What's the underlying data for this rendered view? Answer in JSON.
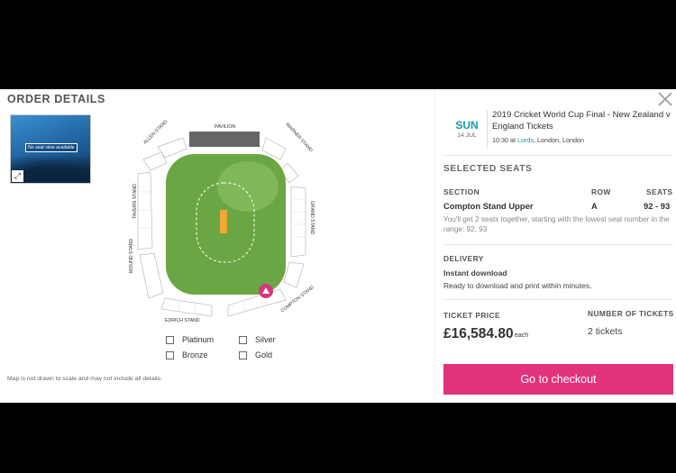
{
  "modal": {
    "title": "ORDER DETAILS",
    "close_icon": "close-icon"
  },
  "seat_view": {
    "no_view_text": "No seat view available",
    "expand_icon": "expand-icon"
  },
  "map": {
    "stands": {
      "pavilion": "PAVILION",
      "allen": "ALLEN STAND",
      "warner": "WARNER STAND",
      "tavern": "TAVERN STAND",
      "grand": "GRAND STAND",
      "mound": "MOUND STAND",
      "edrich": "EDRICH STAND",
      "compton": "COMPTON STAND"
    },
    "marker_icon": "seat-location-icon",
    "colors": {
      "field": "#6ba644",
      "pavilion": "#666666",
      "marker": "#d6357d"
    }
  },
  "legend": {
    "items": [
      "Platinum",
      "Silver",
      "Bronze",
      "Gold"
    ]
  },
  "disclaimer": "Map is not drawn to scale and may not include all details.",
  "event": {
    "day_of_week": "SUN",
    "date": "14 JUL",
    "title": "2019 Cricket World Cup Final - New Zealand v England Tickets",
    "time": "10:30",
    "at": "at",
    "venue_name": "Lords",
    "venue_location": ", London, London",
    "accent_color": "#1a9aaa"
  },
  "selected_seats": {
    "title": "SELECTED SEATS",
    "headers": {
      "section": "SECTION",
      "row": "ROW",
      "seats": "SEATS"
    },
    "section": "Compton Stand Upper",
    "row": "A",
    "seats": "92 - 93",
    "note": "You'll get 2 seats together, starting with the lowest seat number in the range:  92, 93"
  },
  "delivery": {
    "label": "DELIVERY",
    "type": "Instant download",
    "description": "Ready to download and print within minutes."
  },
  "ticket_price": {
    "label": "TICKET PRICE",
    "price": "£16,584.80",
    "unit": "each"
  },
  "ticket_count": {
    "label": "NUMBER OF TICKETS",
    "value": "2 tickets"
  },
  "checkout": {
    "label": "Go to checkout",
    "color": "#e1337c"
  }
}
